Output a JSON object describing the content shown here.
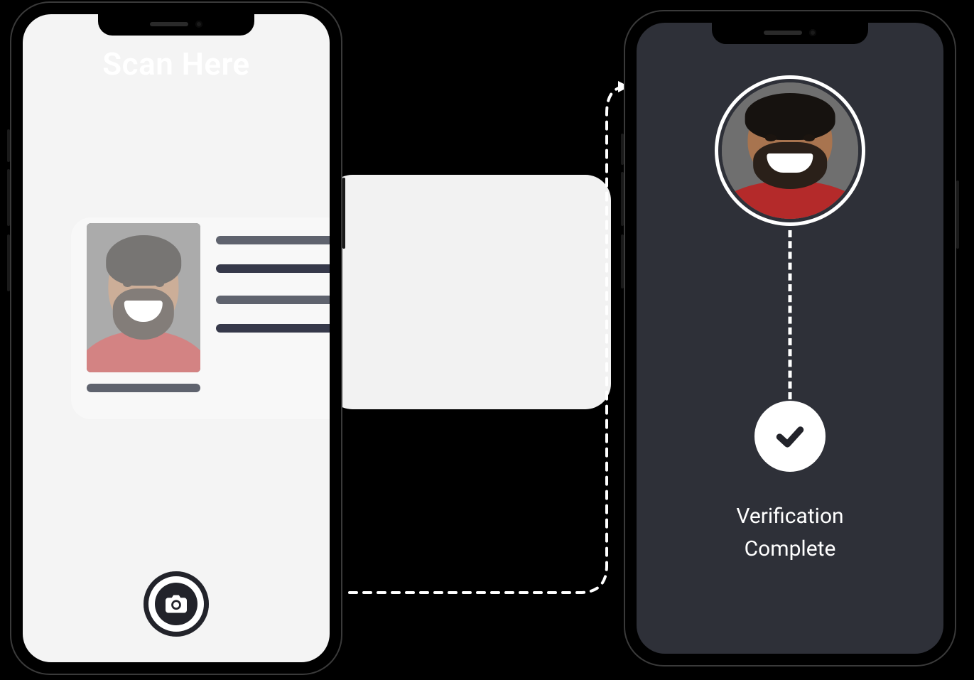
{
  "scan_screen": {
    "title": "Scan Here",
    "shutter_icon": "camera-icon"
  },
  "verify_screen": {
    "status_line1": "Verification",
    "status_line2": "Complete",
    "badge_icon": "check-icon",
    "avatar": "user-portrait"
  },
  "id_card": {
    "photo": "user-portrait",
    "line_style_a": "#5f636e",
    "line_style_b": "#36394a"
  },
  "flow_arrow": "dashed-arrow"
}
